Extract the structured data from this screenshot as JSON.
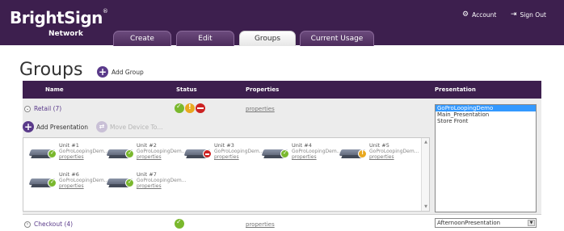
{
  "brand": {
    "name": "BrightSign",
    "trademark": "®",
    "sub": "Network"
  },
  "tabs": [
    {
      "label": "Create"
    },
    {
      "label": "Edit"
    },
    {
      "label": "Groups"
    },
    {
      "label": "Current Usage"
    }
  ],
  "header_links": {
    "account": "Account",
    "sign_out": "Sign Out"
  },
  "page": {
    "title": "Groups",
    "add_group": "Add Group"
  },
  "table": {
    "columns": {
      "name": "Name",
      "status": "Status",
      "properties": "Properties",
      "presentation": "Presentation"
    }
  },
  "groups": [
    {
      "name": "Retail (7)",
      "properties": "properties",
      "actions": {
        "add_presentation": "Add Presentation",
        "move_device": "Move Device To..."
      },
      "presentations": [
        "GoProLoopingDemo",
        "Main_Presentation",
        "Store Front"
      ],
      "devices": [
        {
          "unit": "Unit #1",
          "presentation": "GoProLoopingDem...",
          "link": "properties",
          "status": "ok"
        },
        {
          "unit": "Unit #2",
          "presentation": "GoProLoopingDem...",
          "link": "properties",
          "status": "ok"
        },
        {
          "unit": "Unit #3",
          "presentation": "GoProLoopingDem...",
          "link": "properties",
          "status": "err"
        },
        {
          "unit": "Unit #4",
          "presentation": "GoProLoopingDem...",
          "link": "properties",
          "status": "ok"
        },
        {
          "unit": "Unit #5",
          "presentation": "GoProLoopingDem...",
          "link": "properties",
          "status": "warn"
        },
        {
          "unit": "Unit #6",
          "presentation": "GoProLoopingDem...",
          "link": "properties",
          "status": "ok"
        },
        {
          "unit": "Unit #7",
          "presentation": "GoProLoopingDem...",
          "link": "properties",
          "status": "ok"
        }
      ]
    },
    {
      "name": "Checkout (4)",
      "properties": "properties",
      "presentation_selected": "AfternoonPresentation"
    }
  ],
  "colors": {
    "header_bg": "#3d1f4e",
    "selected": "#3399ff",
    "ok": "#7ab82d",
    "warn": "#e9a81f",
    "err": "#cc2222"
  }
}
